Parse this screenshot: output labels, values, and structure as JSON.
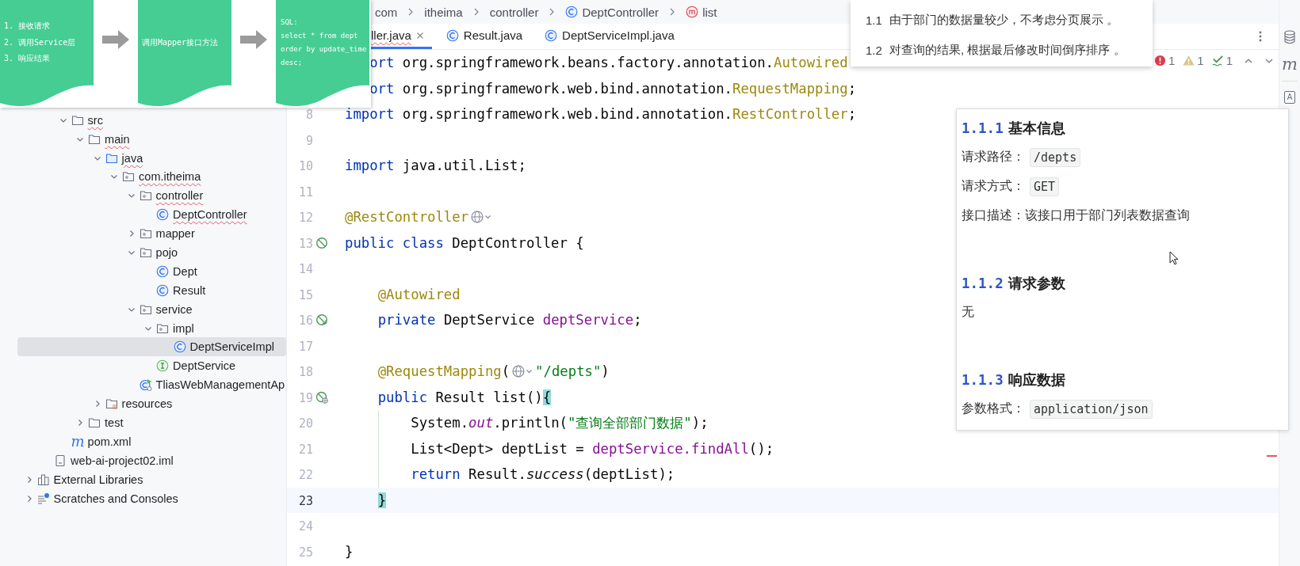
{
  "flowchart": {
    "steps": [
      {
        "kind": "text",
        "lines": [
          "1. 接收请求",
          "2. 调用Service层",
          "3. 响应结果"
        ]
      },
      {
        "kind": "text",
        "lines": [
          "调用Mapper接口方法"
        ]
      },
      {
        "kind": "code",
        "lines": [
          "SQL:",
          "select * from dept",
          "order by update_time",
          "desc;"
        ]
      }
    ]
  },
  "tree": {
    "items": [
      {
        "kind": "covered",
        "children": [
          {
            "kind": "covered",
            "children": [
              {
                "kind": "folder",
                "label": "src",
                "expanded": true,
                "selected": false,
                "has_errors": true,
                "children": [
                  {
                    "kind": "folder",
                    "label": "main",
                    "expanded": true,
                    "selected": false,
                    "has_errors": true,
                    "children": [
                      {
                        "kind": "source_folder",
                        "label": "java",
                        "expanded": true,
                        "selected": false,
                        "has_errors": true,
                        "children": [
                          {
                            "kind": "package",
                            "label": "com.itheima",
                            "expanded": true,
                            "selected": false,
                            "has_errors": true,
                            "children": [
                              {
                                "kind": "package",
                                "label": "controller",
                                "expanded": true,
                                "selected": false,
                                "has_errors": true,
                                "children": [
                                  {
                                    "kind": "class",
                                    "label": "DeptController",
                                    "selected": false,
                                    "has_errors": true
                                  }
                                ]
                              },
                              {
                                "kind": "package",
                                "label": "mapper",
                                "expanded": false,
                                "selected": false,
                                "has_errors": false
                              },
                              {
                                "kind": "package",
                                "label": "pojo",
                                "expanded": true,
                                "selected": false,
                                "has_errors": false,
                                "children": [
                                  {
                                    "kind": "class",
                                    "label": "Dept",
                                    "selected": false,
                                    "has_errors": false
                                  },
                                  {
                                    "kind": "class",
                                    "label": "Result",
                                    "selected": false,
                                    "has_errors": false
                                  }
                                ]
                              },
                              {
                                "kind": "package",
                                "label": "service",
                                "expanded": true,
                                "selected": false,
                                "has_errors": false,
                                "children": [
                                  {
                                    "kind": "package",
                                    "label": "impl",
                                    "expanded": true,
                                    "selected": false,
                                    "has_errors": false,
                                    "children": [
                                      {
                                        "kind": "class",
                                        "label": "DeptServiceImpl",
                                        "selected": true,
                                        "has_errors": false
                                      }
                                    ]
                                  },
                                  {
                                    "kind": "interface",
                                    "label": "DeptService",
                                    "selected": false,
                                    "has_errors": false
                                  }
                                ]
                              },
                              {
                                "kind": "app",
                                "label": "TliasWebManagementAp",
                                "selected": false,
                                "has_errors": false
                              }
                            ]
                          }
                        ]
                      },
                      {
                        "kind": "resources",
                        "label": "resources",
                        "expanded": false,
                        "selected": false,
                        "has_errors": false
                      }
                    ]
                  },
                  {
                    "kind": "folder",
                    "label": "test",
                    "expanded": false,
                    "selected": false,
                    "has_errors": false
                  }
                ]
              },
              {
                "kind": "maven",
                "glyph": "m",
                "label": "pom.xml",
                "selected": false,
                "has_errors": false
              }
            ]
          },
          {
            "kind": "iml",
            "label": "web-ai-project02.iml",
            "selected": false,
            "has_errors": false
          }
        ]
      },
      {
        "kind": "libraries",
        "label": "External Libraries",
        "expanded": false,
        "selected": false,
        "has_errors": false
      },
      {
        "kind": "scratches",
        "label": "Scratches and Consoles",
        "expanded": false,
        "selected": false,
        "has_errors": false
      }
    ]
  },
  "breadcrumb": [
    {
      "kind": "plain",
      "label": "com"
    },
    {
      "kind": "plain",
      "label": "itheima"
    },
    {
      "kind": "plain",
      "label": "controller"
    },
    {
      "kind": "class",
      "label": "DeptController"
    },
    {
      "kind": "method",
      "label": "list"
    }
  ],
  "tabs": [
    {
      "kind": "plain",
      "label": "ller.java",
      "selected": true,
      "has_errors": true
    },
    {
      "kind": "class",
      "label": "Result.java",
      "selected": false,
      "has_errors": false
    },
    {
      "kind": "class",
      "label": "DeptServiceImpl.java",
      "selected": false,
      "has_errors": false
    }
  ],
  "inspections": [
    {
      "kind": "error",
      "count": "1"
    },
    {
      "kind": "warning",
      "count": "1"
    },
    {
      "kind": "typo",
      "count": "1"
    }
  ],
  "code": {
    "lines": [
      {
        "kind": "plain",
        "cut_left": true,
        "current": false,
        "segments": [
          {
            "kind": "keyword",
            "text": "ort"
          },
          {
            "kind": "plain",
            "text": " org.springframework.beans.factory.annotation."
          },
          {
            "kind": "annotation",
            "text": "Autowired"
          }
        ]
      },
      {
        "kind": "plain",
        "cut_left": true,
        "current": false,
        "segments": [
          {
            "kind": "keyword",
            "text": "ort"
          },
          {
            "kind": "plain",
            "text": " org.springframework.web.bind.annotation."
          },
          {
            "kind": "annotation",
            "text": "RequestMapping"
          },
          {
            "kind": "plain",
            "text": ";"
          }
        ]
      },
      {
        "kind": "plain",
        "number": "8",
        "current": false,
        "segments": [
          {
            "kind": "keyword",
            "text": "import"
          },
          {
            "kind": "plain",
            "text": " org.springframework.web.bind.annotation."
          },
          {
            "kind": "annotation",
            "text": "RestController"
          },
          {
            "kind": "plain",
            "text": ";"
          }
        ]
      },
      {
        "kind": "plain",
        "number": "9",
        "current": false
      },
      {
        "kind": "plain",
        "number": "10",
        "current": false,
        "segments": [
          {
            "kind": "keyword",
            "text": "import"
          },
          {
            "kind": "plain",
            "text": " java.util.List;"
          }
        ]
      },
      {
        "kind": "plain",
        "number": "11",
        "current": false
      },
      {
        "kind": "plain",
        "number": "12",
        "current": false,
        "segments": [
          {
            "kind": "annotation",
            "text": "@RestController"
          },
          {
            "kind": "globe"
          }
        ]
      },
      {
        "kind": "bean",
        "number": "13",
        "current": false,
        "segments": [
          {
            "kind": "keyword",
            "text": "public class"
          },
          {
            "kind": "plain",
            "text": " DeptController {"
          }
        ]
      },
      {
        "kind": "plain",
        "number": "14",
        "current": false
      },
      {
        "kind": "plain",
        "number": "15",
        "current": false,
        "segments": [
          {
            "kind": "annotation",
            "text": "    @Autowired"
          }
        ]
      },
      {
        "kind": "bean_link",
        "number": "16",
        "current": false,
        "segments": [
          {
            "kind": "keyword",
            "text": "    private"
          },
          {
            "kind": "plain",
            "text": " DeptService "
          },
          {
            "kind": "field",
            "text": "deptService"
          },
          {
            "kind": "plain",
            "text": ";"
          }
        ]
      },
      {
        "kind": "plain",
        "number": "17",
        "current": false
      },
      {
        "kind": "plain",
        "number": "18",
        "current": false,
        "segments": [
          {
            "kind": "annotation",
            "text": "    @RequestMapping"
          },
          {
            "kind": "plain",
            "text": "("
          },
          {
            "kind": "globe"
          },
          {
            "kind": "string",
            "text": "\"/depts\""
          },
          {
            "kind": "plain",
            "text": ")"
          }
        ]
      },
      {
        "kind": "endpoint",
        "number": "19",
        "current": false,
        "segments": [
          {
            "kind": "keyword",
            "text": "    public"
          },
          {
            "kind": "plain",
            "text": " Result list()"
          },
          {
            "kind": "brace",
            "text": "{"
          }
        ]
      },
      {
        "kind": "plain",
        "number": "20",
        "current": false,
        "guide": true,
        "segments": [
          {
            "kind": "plain",
            "text": "        System."
          },
          {
            "kind": "static_field",
            "text": "out"
          },
          {
            "kind": "plain",
            "text": ".println("
          },
          {
            "kind": "string",
            "text": "\"查询全部部门数据\""
          },
          {
            "kind": "plain",
            "text": ");"
          }
        ]
      },
      {
        "kind": "plain",
        "number": "21",
        "current": false,
        "guide": true,
        "segments": [
          {
            "kind": "plain",
            "text": "        List<Dept> deptList = "
          },
          {
            "kind": "field",
            "text": "deptService.findAll"
          },
          {
            "kind": "plain",
            "text": "();"
          }
        ]
      },
      {
        "kind": "plain",
        "number": "22",
        "current": false,
        "guide": true,
        "segments": [
          {
            "kind": "keyword",
            "text": "        return"
          },
          {
            "kind": "plain",
            "text": " Result."
          },
          {
            "kind": "static_method",
            "text": "success"
          },
          {
            "kind": "plain",
            "text": "(deptList);"
          }
        ]
      },
      {
        "kind": "plain",
        "number": "23",
        "current": true,
        "segments": [
          {
            "kind": "brace",
            "text": "    }"
          }
        ]
      },
      {
        "kind": "plain",
        "number": "24",
        "current": false
      },
      {
        "kind": "plain",
        "number": "25",
        "current": false,
        "segments": [
          {
            "kind": "plain",
            "text": "}"
          }
        ]
      }
    ]
  },
  "note_popup": {
    "items": [
      {
        "number": "1.1",
        "text": "由于部门的数据量较少，不考虑分页展示 。"
      },
      {
        "number": "1.2",
        "text": "对查询的结果, 根据最后修改时间倒序排序 。"
      }
    ]
  },
  "doc_panel": {
    "blocks": [
      {
        "kind": "heading",
        "number": "1.1.1",
        "text": "基本信息"
      },
      {
        "kind": "field",
        "label": "请求路径：",
        "code": "/depts"
      },
      {
        "kind": "field",
        "label": "请求方式：",
        "code": "GET"
      },
      {
        "kind": "paragraph",
        "text": "接口描述：该接口用于部门列表数据查询"
      },
      {
        "kind": "heading",
        "number": "1.1.2",
        "text": "请求参数"
      },
      {
        "kind": "paragraph",
        "text": "无"
      },
      {
        "kind": "heading",
        "number": "1.1.3",
        "text": "响应数据"
      },
      {
        "kind": "field",
        "label": "参数格式：",
        "code": "application/json"
      }
    ]
  },
  "side_toolbar": [
    {
      "kind": "database"
    },
    {
      "kind": "maven",
      "glyph": "m"
    },
    {
      "kind": "assistant",
      "glyph": "A"
    }
  ]
}
